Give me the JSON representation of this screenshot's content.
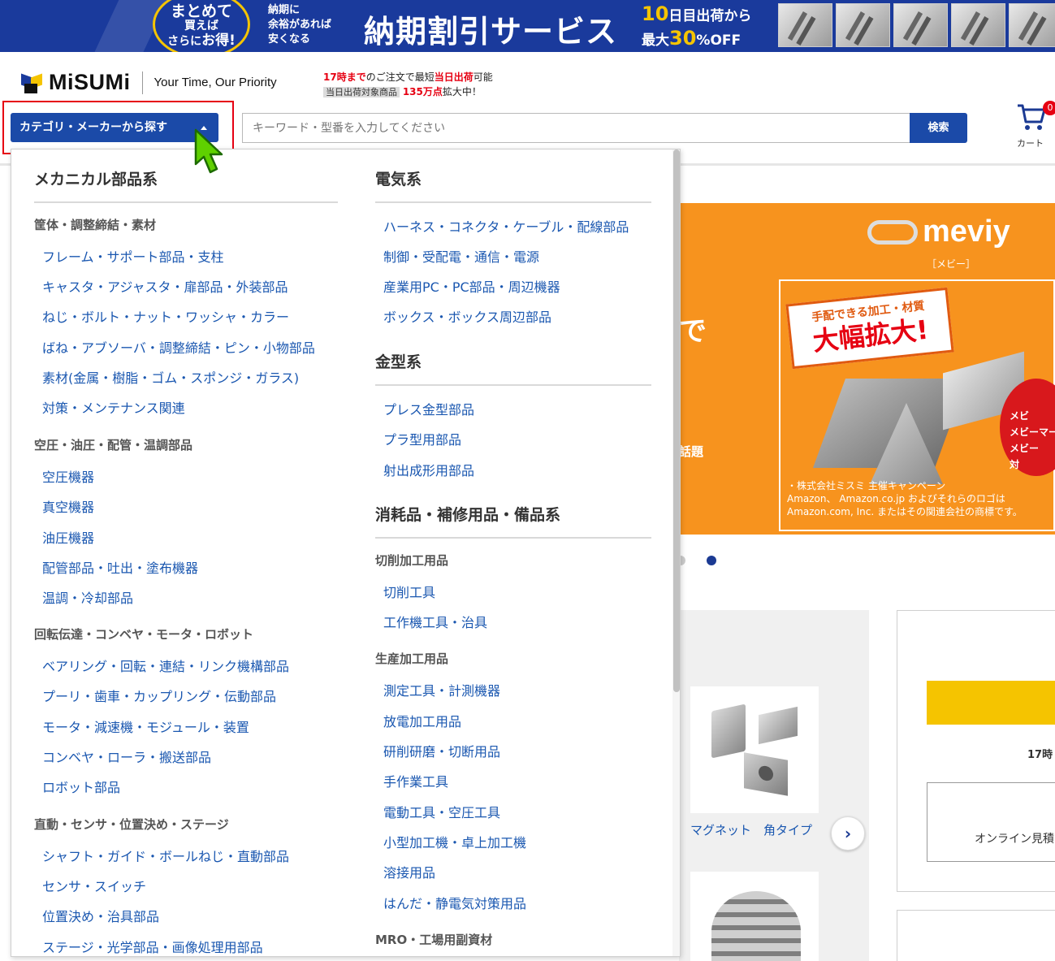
{
  "banner": {
    "circle_line1": "まとめて",
    "circle_line2": "買えば",
    "circle_line3_pre": "さらに",
    "circle_line3_em": "お得!",
    "note_line1": "納期に",
    "note_line2": "余裕があれば",
    "note_line3": "安くなる",
    "headline": "納期割引サービス",
    "offer_line1_num": "10",
    "offer_line1_rest": "日目出荷から",
    "offer_line2_pre": "最大",
    "offer_line2_num": "30",
    "offer_line2_rest": "%OFF"
  },
  "header": {
    "logo_text": "MiSUMi",
    "tagline": "Your Time, Our Priority",
    "ship_line1_red": "17時まで",
    "ship_line1_mid": "のご注文で最短",
    "ship_line1_red2": "当日出荷",
    "ship_line1_end": "可能",
    "ship_line2_label": "当日出荷対象商品",
    "ship_line2_red": "135万点",
    "ship_line2_end": "拡大中！",
    "category_button": "カテゴリ・メーカーから探す",
    "search_placeholder": "キーワード・型番を入力してください",
    "search_button": "検索",
    "cart_label": "カート",
    "cart_badge": "0"
  },
  "dropdown": {
    "mechanical": {
      "title": "メカニカル部品系",
      "groups": [
        {
          "label": "筐体・調整締結・素材",
          "items": [
            "フレーム・サポート部品・支柱",
            "キャスタ・アジャスタ・扉部品・外装部品",
            "ねじ・ボルト・ナット・ワッシャ・カラー",
            "ばね・アブソーバ・調整締結・ピン・小物部品",
            "素材(金属・樹脂・ゴム・スポンジ・ガラス)",
            "対策・メンテナンス関連"
          ]
        },
        {
          "label": "空圧・油圧・配管・温調部品",
          "items": [
            "空圧機器",
            "真空機器",
            "油圧機器",
            "配管部品・吐出・塗布機器",
            "温調・冷却部品"
          ]
        },
        {
          "label": "回転伝達・コンベヤ・モータ・ロボット",
          "items": [
            "ベアリング・回転・連結・リンク機構部品",
            "プーリ・歯車・カップリング・伝動部品",
            "モータ・減速機・モジュール・装置",
            "コンベヤ・ローラ・搬送部品",
            "ロボット部品"
          ]
        },
        {
          "label": "直動・センサ・位置決め・ステージ",
          "items": [
            "シャフト・ガイド・ボールねじ・直動部品",
            "センサ・スイッチ",
            "位置決め・治具部品",
            "ステージ・光学部品・画像処理用部品"
          ]
        }
      ]
    },
    "electrical": {
      "title": "電気系",
      "items": [
        "ハーネス・コネクタ・ケーブル・配線部品",
        "制御・受配電・通信・電源",
        "産業用PC・PC部品・周辺機器",
        "ボックス・ボックス周辺部品"
      ]
    },
    "mold": {
      "title": "金型系",
      "items": [
        "プレス金型部品",
        "プラ型用部品",
        "射出成形用部品"
      ]
    },
    "consumables": {
      "title": "消耗品・補修用品・備品系",
      "groups": [
        {
          "label": "切削加工用品",
          "items": [
            "切削工具",
            "工作機工具・治具"
          ]
        },
        {
          "label": "生産加工用品",
          "items": [
            "測定工具・計測機器",
            "放電加工用品",
            "研削研磨・切断用品",
            "手作業工具",
            "電動工具・空圧工具",
            "小型加工機・卓上加工機",
            "溶接用品",
            "はんだ・静電気対策用品"
          ]
        },
        {
          "label": "MRO・工場用副資材",
          "items": []
        }
      ]
    }
  },
  "background": {
    "hero_char": "で",
    "hero_char2": "話題",
    "meviy_word": "meviy",
    "meviy_sub": "［メビー］",
    "bubble_l1": "手配できる加工・材質",
    "bubble_l2": "大幅拡大!",
    "apple_l1": "メビ",
    "apple_l2": "メビーマーケ",
    "apple_l3": "メビー",
    "apple_l4": "対",
    "note_l1": "・株式会社ミスミ 主催キャンペーン",
    "note_l2": "Amazon、 Amazon.co.jp およびそれらのロゴは",
    "note_l3": "Amazon.com, Inc. またはその関連会社の商標です。",
    "product_label": "マグネット　角タイプ",
    "next_arrow": "›",
    "right_17": "17時",
    "right_quote": "オンライン見積"
  },
  "colors": {
    "brand_blue": "#1b4aa8",
    "link_blue": "#1a57b0",
    "accent_red": "#e60012",
    "banner_navy": "#1a3a9c",
    "meviy_orange": "#f7931e",
    "yellow": "#f5c400"
  }
}
